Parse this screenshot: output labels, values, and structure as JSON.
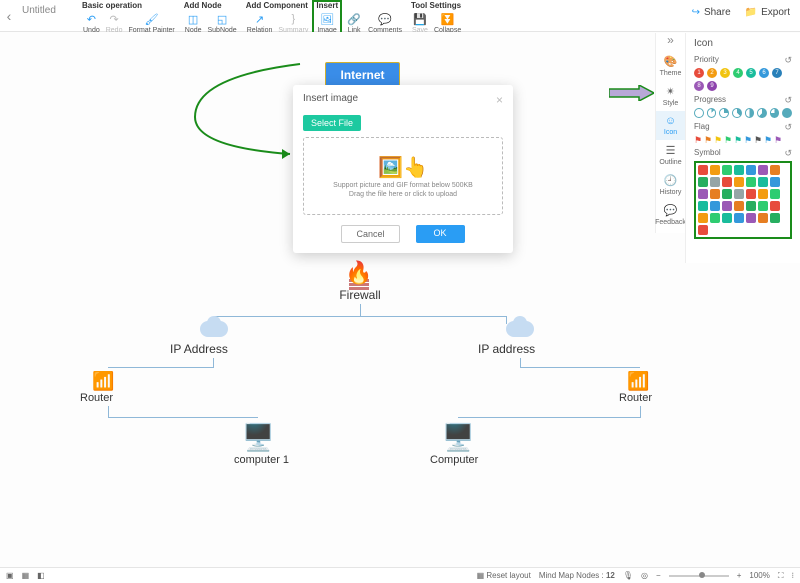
{
  "doc": {
    "title": "Untitled"
  },
  "toolbar": {
    "groups": {
      "basic": {
        "label": "Basic operation",
        "undo": "Undo",
        "redo": "Redo",
        "format_painter": "Format Painter"
      },
      "addnode": {
        "label": "Add Node",
        "node": "Node",
        "subnode": "SubNode"
      },
      "addcomponent": {
        "label": "Add Component",
        "relation": "Relation",
        "summary": "Summary"
      },
      "insert": {
        "label": "Insert",
        "image": "Image",
        "link": "Link",
        "comments": "Comments"
      },
      "toolsettings": {
        "label": "Tool Settings",
        "save": "Save",
        "collapse": "Collapse"
      }
    },
    "share": "Share",
    "export": "Export"
  },
  "canvas": {
    "internet": "Internet",
    "firewall": "Firewall",
    "ip_left": "IP Address",
    "ip_right": "IP address",
    "router_left": "Router",
    "router_right": "Router",
    "computer_left": "computer 1",
    "computer_right": "Computer"
  },
  "modal": {
    "title": "Insert image",
    "select_file": "Select File",
    "support_text": "Support picture and GIF format below 500KB",
    "drag_text": "Drag the file here or click to upload",
    "cancel": "Cancel",
    "ok": "OK"
  },
  "rail": {
    "theme": "Theme",
    "style": "Style",
    "icon": "Icon",
    "outline": "Outline",
    "history": "History",
    "feedback": "Feedback"
  },
  "icon_panel": {
    "title": "Icon",
    "priority": "Priority",
    "progress": "Progress",
    "flag": "Flag",
    "symbol": "Symbol",
    "priority_colors": [
      "#e74c3c",
      "#f39c12",
      "#f1c40f",
      "#2ecc71",
      "#1abc9c",
      "#3498db",
      "#2980b9",
      "#9b59b6",
      "#8e44ad"
    ],
    "flag_colors": [
      "#e74c3c",
      "#e67e22",
      "#f1c40f",
      "#2ecc71",
      "#1abc9c",
      "#3498db",
      "#555",
      "#3498db",
      "#9b59b6"
    ],
    "symbol_colors": [
      "#e74c3c",
      "#f39c12",
      "#2ecc71",
      "#1abc9c",
      "#3498db",
      "#9b59b6",
      "#e67e22",
      "#27ae60",
      "#95a5a6",
      "#e74c3c",
      "#f39c12",
      "#2ecc71",
      "#1abc9c",
      "#3498db",
      "#9b59b6",
      "#e67e22",
      "#27ae60",
      "#95a5a6",
      "#e74c3c",
      "#f39c12",
      "#2ecc71",
      "#1abc9c",
      "#3498db",
      "#9b59b6",
      "#e67e22",
      "#27ae60",
      "#2ecc71",
      "#e74c3c",
      "#f39c12",
      "#2ecc71",
      "#1abc9c",
      "#3498db",
      "#9b59b6",
      "#e67e22",
      "#27ae60",
      "#e74c3c"
    ]
  },
  "bottom": {
    "reset": "Reset layout",
    "nodes_label": "Mind Map Nodes :",
    "nodes_count": "12",
    "zoom": "100%"
  }
}
